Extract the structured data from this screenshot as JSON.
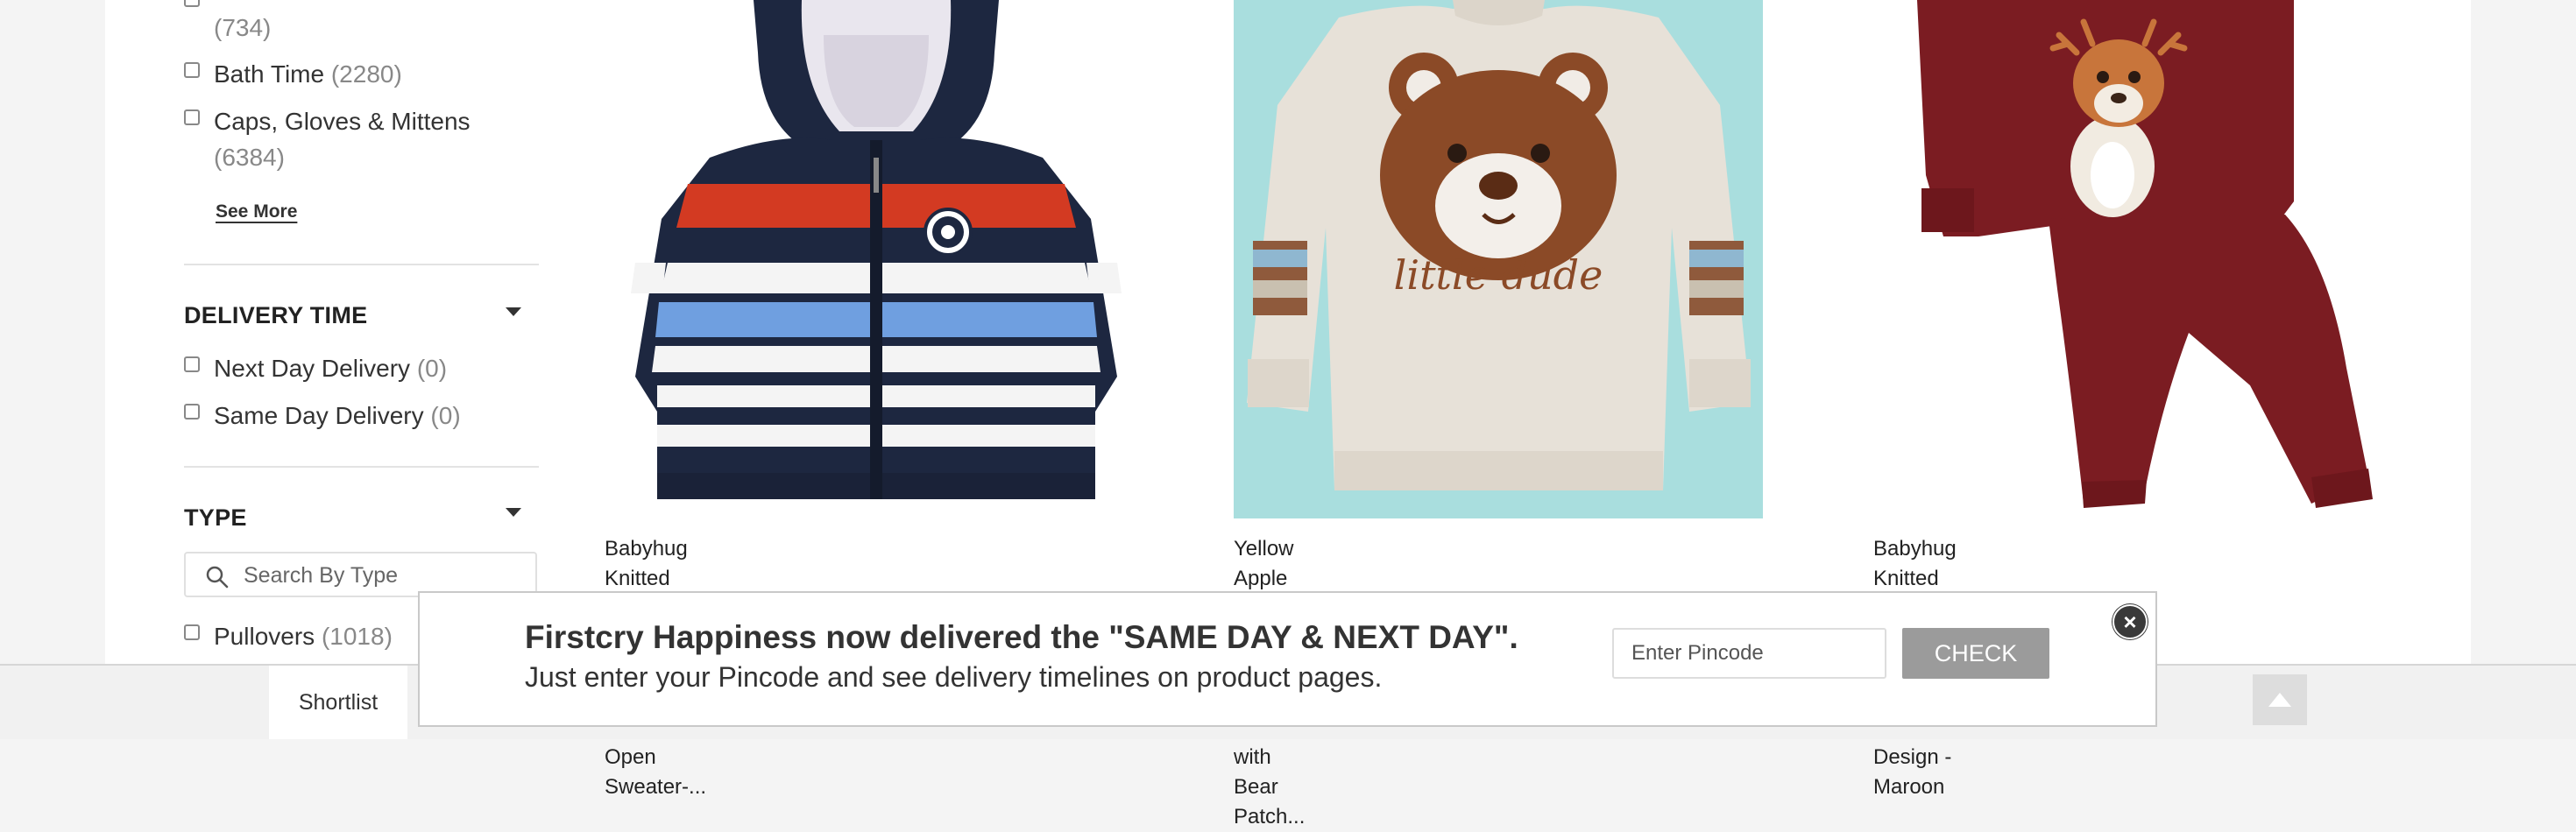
{
  "sidebar": {
    "category_items": [
      {
        "label": "",
        "count": "(734)"
      },
      {
        "label": "Bath Time",
        "count": "(2280)"
      },
      {
        "label": "Caps, Gloves & Mittens",
        "count": "(6384)"
      }
    ],
    "see_more": "See More",
    "delivery_time": {
      "title": "DELIVERY TIME",
      "items": [
        {
          "label": "Next Day Delivery",
          "count": "(0)"
        },
        {
          "label": "Same Day Delivery",
          "count": "(0)"
        }
      ]
    },
    "type": {
      "title": "TYPE",
      "search_placeholder": "Search By Type",
      "items": [
        {
          "label": "Pullovers",
          "count": "(1018)"
        }
      ]
    }
  },
  "products": [
    {
      "name_line1": "Babyhug Knitted Full Sleeves Striped Hooded Front",
      "name_line2": "Open Sweater-..."
    },
    {
      "name_line1": "Yellow Apple Knitted Full Sleeves Pullovers Sweater",
      "name_line2": "with Bear Patch...",
      "image_text": "little dude"
    },
    {
      "name_line1": "Babyhug Knitted Full Sleeves Sweater Set with Deer",
      "name_line2": "Design - Maroon"
    }
  ],
  "bottom_bar": {
    "shortlist_label": "Shortlist",
    "scroll_top_icon": "triangle-up-icon"
  },
  "popup": {
    "headline": "Firstcry Happiness now delivered the \"SAME DAY & NEXT DAY\".",
    "subtext": "Just enter your Pincode and see delivery timelines on product pages.",
    "pincode_placeholder": "Enter Pincode",
    "check_label": "CHECK",
    "close_icon": "close-icon"
  },
  "colors": {
    "page_bg": "#f4f4f4",
    "check_button": "#9b9b9b",
    "popup_border": "#c9c9c9"
  }
}
